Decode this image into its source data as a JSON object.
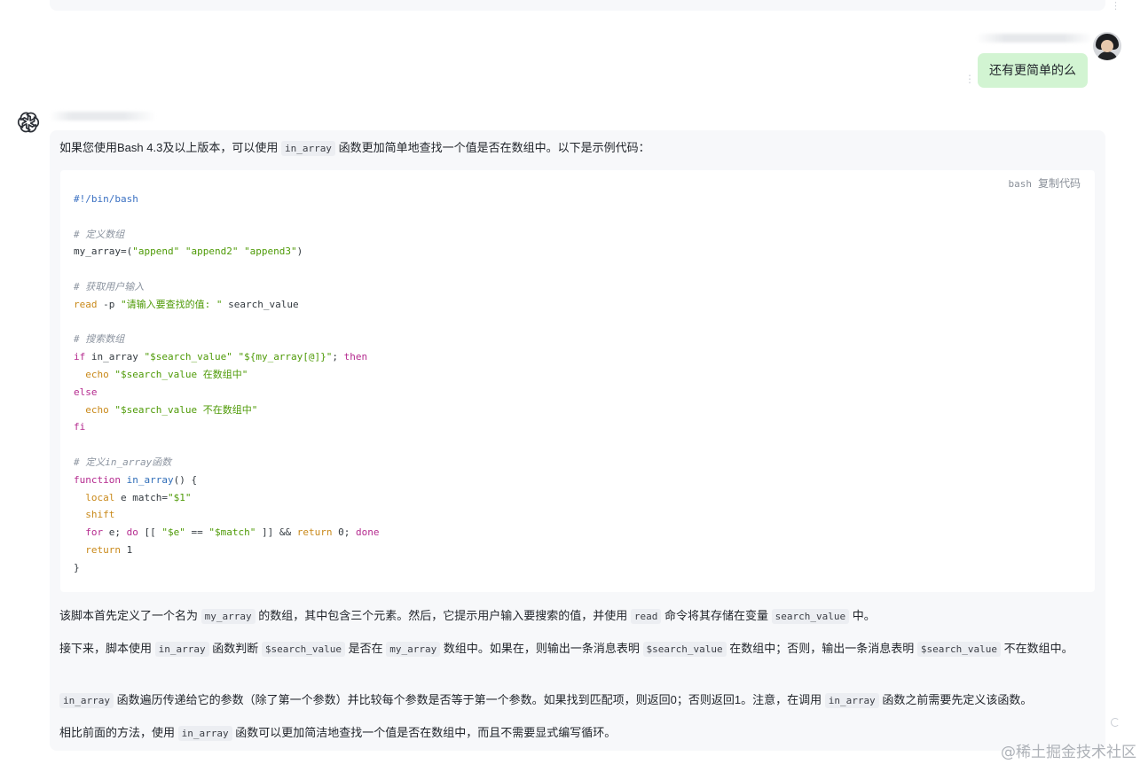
{
  "user_message": {
    "text": "还有更简单的么",
    "more_icon": "vertical-dots-icon"
  },
  "assistant": {
    "icon": "openai-logo-icon",
    "intro": {
      "a": "如果您使用Bash 4.3及以上版本，可以使用",
      "code1": "in_array",
      "b": "函数更加简单地查找一个值是否在数组中。以下是示例代码："
    },
    "code_block": {
      "language": "bash",
      "copy_label": "复制代码",
      "lines": {
        "shebang": "#!/bin/bash",
        "comment1": "# 定义数组",
        "array_name": "my_array=(",
        "array_values": "\"append\" \"append2\" \"append3\"",
        "array_close": ")",
        "comment2": "# 获取用户输入",
        "read_kw": "read",
        "read_flag": " -p ",
        "read_prompt": "\"请输入要查找的值: \"",
        "read_var": " search_value",
        "comment3": "# 搜索数组",
        "if_kw": "if",
        "if_call": " in_array ",
        "if_arg1": "\"$search_value\"",
        "if_arg2": "\"${my_array[@]}\"",
        "if_semicolon": "; ",
        "then_kw": "then",
        "echo1_kw": "echo",
        "echo1_str": "\"$search_value 在数组中\"",
        "else_kw": "else",
        "echo2_kw": "echo",
        "echo2_str": "\"$search_value 不在数组中\"",
        "fi_kw": "fi",
        "comment4": "# 定义in_array函数",
        "function_kw": "function",
        "function_name": "in_array",
        "function_paren": "() {",
        "local_kw": "local",
        "local_rest": " e match=",
        "local_str": "\"$1\"",
        "shift_kw": "shift",
        "for_kw": "for",
        "for_var": " e; ",
        "do_kw": "do",
        "for_test_open": " [[ ",
        "for_e": "\"$e\"",
        "for_eq": " == ",
        "for_match": "\"$match\"",
        "for_test_close": " ]] && ",
        "return0_kw": "return",
        "return0_val": " 0; ",
        "done_kw": "done",
        "return1_kw": "return",
        "return1_val": " 1",
        "close_brace": "}"
      }
    },
    "p1": {
      "a": "该脚本首先定义了一个名为",
      "c1": "my_array",
      "b": "的数组，其中包含三个元素。然后，它提示用户输入要搜索的值，并使用",
      "c2": "read",
      "c": "命令将其存储在变量",
      "c3": "search_value",
      "d": "中。"
    },
    "p2": {
      "a": "接下来，脚本使用",
      "c1": "in_array",
      "b": "函数判断",
      "c2": "$search_value",
      "c": "是否在",
      "c3": "my_array",
      "d": "数组中。如果在，则输出一条消息表明",
      "c4": "$search_value",
      "e": "在数组中；否则，输出一条消息表明",
      "c5": "$search_value",
      "f": "不在数组中。"
    },
    "p3": {
      "c1": "in_array",
      "a": "函数遍历传递给它的参数（除了第一个参数）并比较每个参数是否等于第一个参数。如果找到匹配项，则返回0；否则返回1。注意，在调用",
      "c2": "in_array",
      "b": "函数之前需要先定义该函数。"
    },
    "p4": {
      "a": "相比前面的方法，使用",
      "c1": "in_array",
      "b": "函数可以更加简洁地查找一个值是否在数组中，而且不需要显式编写循环。"
    }
  },
  "watermark": "@稀土掘金技术社区"
}
